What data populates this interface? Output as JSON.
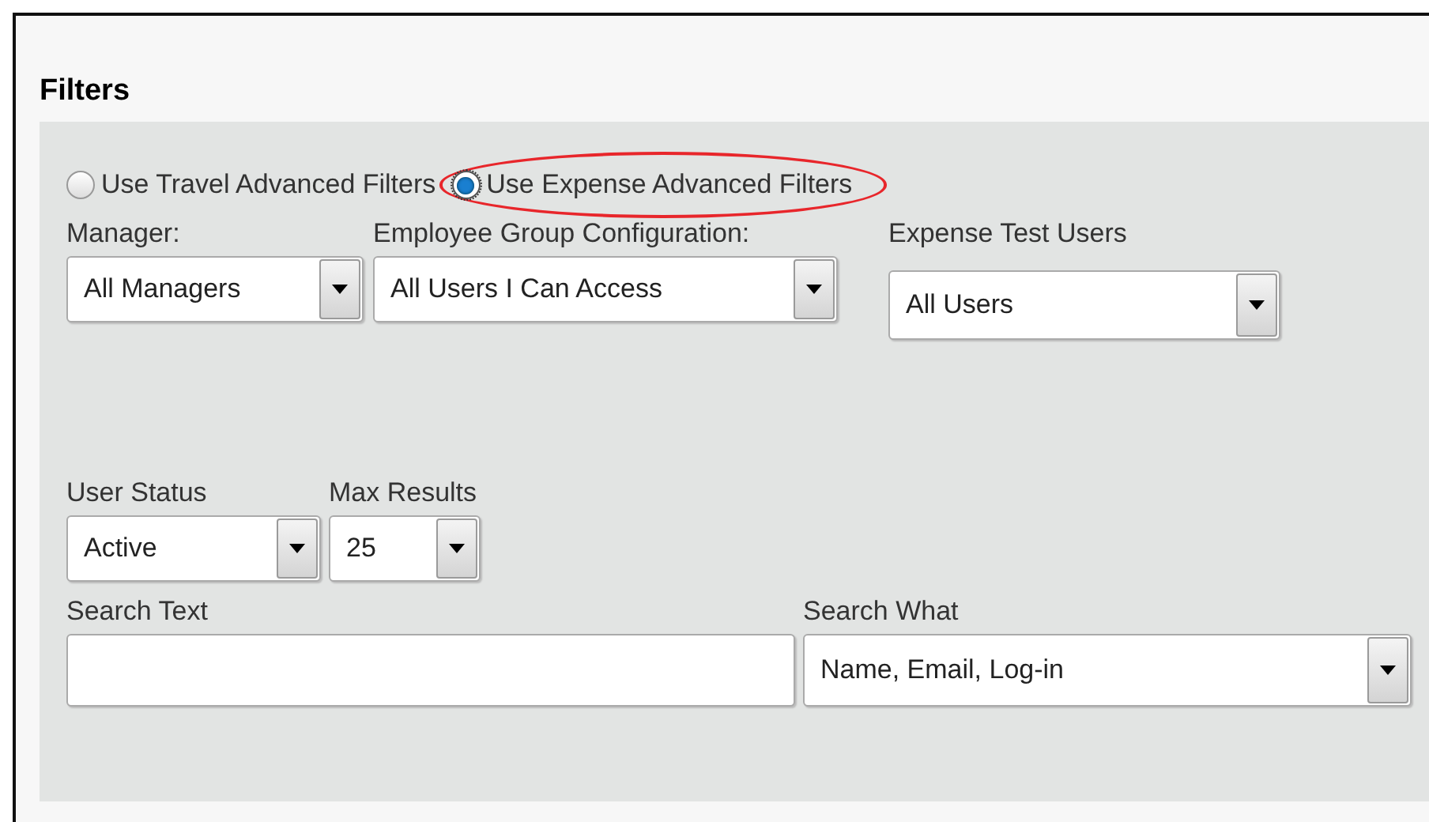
{
  "section_title": "Filters",
  "filter_modes": [
    {
      "label": "Use Travel Advanced Filters",
      "selected": false,
      "highlighted": false
    },
    {
      "label": "Use Expense Advanced Filters",
      "selected": true,
      "highlighted": true
    }
  ],
  "row_1": [
    {
      "label": "Manager:",
      "value": "All Managers",
      "kind": "select"
    },
    {
      "label": "Employee Group Configuration:",
      "value": "All Users I Can Access",
      "kind": "select"
    },
    {
      "label": "Expense Test Users",
      "value": "All Users",
      "kind": "select"
    }
  ],
  "row_2": [
    {
      "label": "User Status",
      "value": "Active",
      "kind": "select"
    },
    {
      "label": "Max Results",
      "value": "25",
      "kind": "select"
    }
  ],
  "row_3": [
    {
      "label": "Search Text",
      "kind": "text"
    },
    {
      "label": "Search What",
      "value": "Name, Email, Log-in",
      "kind": "select"
    }
  ]
}
